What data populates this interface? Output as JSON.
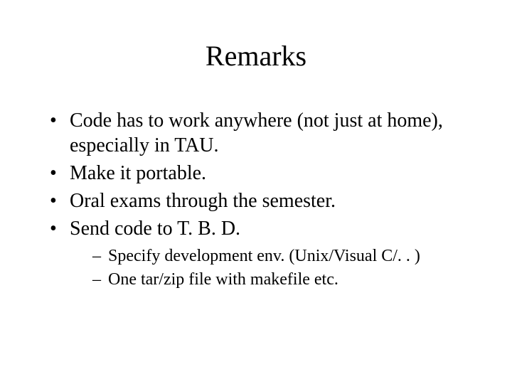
{
  "title": "Remarks",
  "bullets": {
    "b1": "Code has to work anywhere (not just at home), especially in TAU.",
    "b2": "Make it portable.",
    "b3": "Oral exams through the semester.",
    "b4": "Send code to T. B. D."
  },
  "sub_bullets": {
    "s1": "Specify development env. (Unix/Visual C/. . )",
    "s2": "One tar/zip file with makefile etc."
  }
}
